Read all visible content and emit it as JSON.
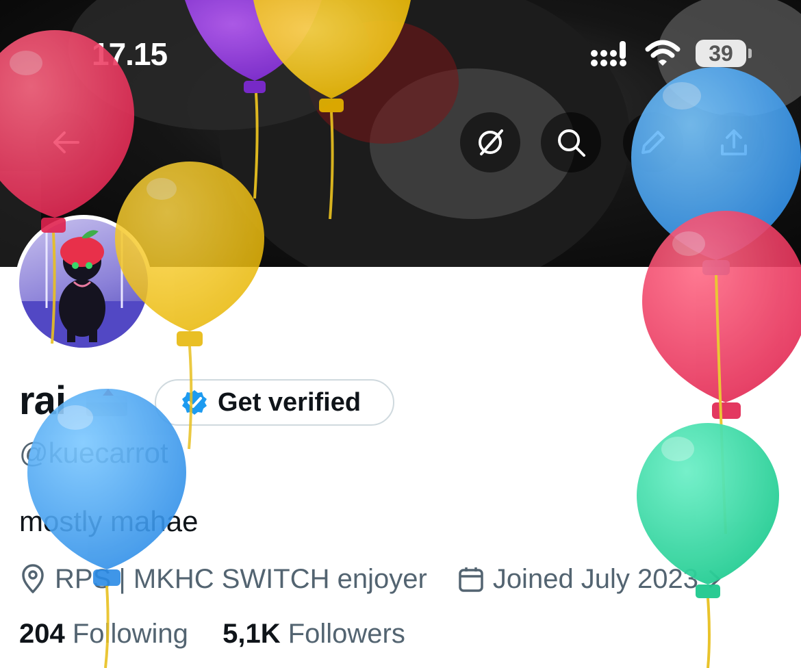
{
  "status_bar": {
    "time": "17.15",
    "battery": "39"
  },
  "profile": {
    "name": "rai",
    "handle": "@kuecarrot",
    "bio": "mostly mahae",
    "location": "RPS | MKHC SWITCH enjoyer",
    "joined": "Joined July 2023",
    "get_verified_label": "Get verified",
    "following_count": "204",
    "following_label": "Following",
    "followers_count": "5,1K",
    "followers_label": "Followers"
  },
  "icons": {
    "back": "arrow-left-icon",
    "grok": "grok-slash-icon",
    "search": "search-icon",
    "edit": "pencil-icon",
    "share": "share-icon",
    "verified": "verified-badge-icon",
    "location": "location-pin-icon",
    "calendar": "calendar-icon"
  },
  "colors": {
    "accent": "#1d9bf0",
    "text": "#0f1419",
    "secondary": "#536471",
    "border": "#cfd9de"
  }
}
